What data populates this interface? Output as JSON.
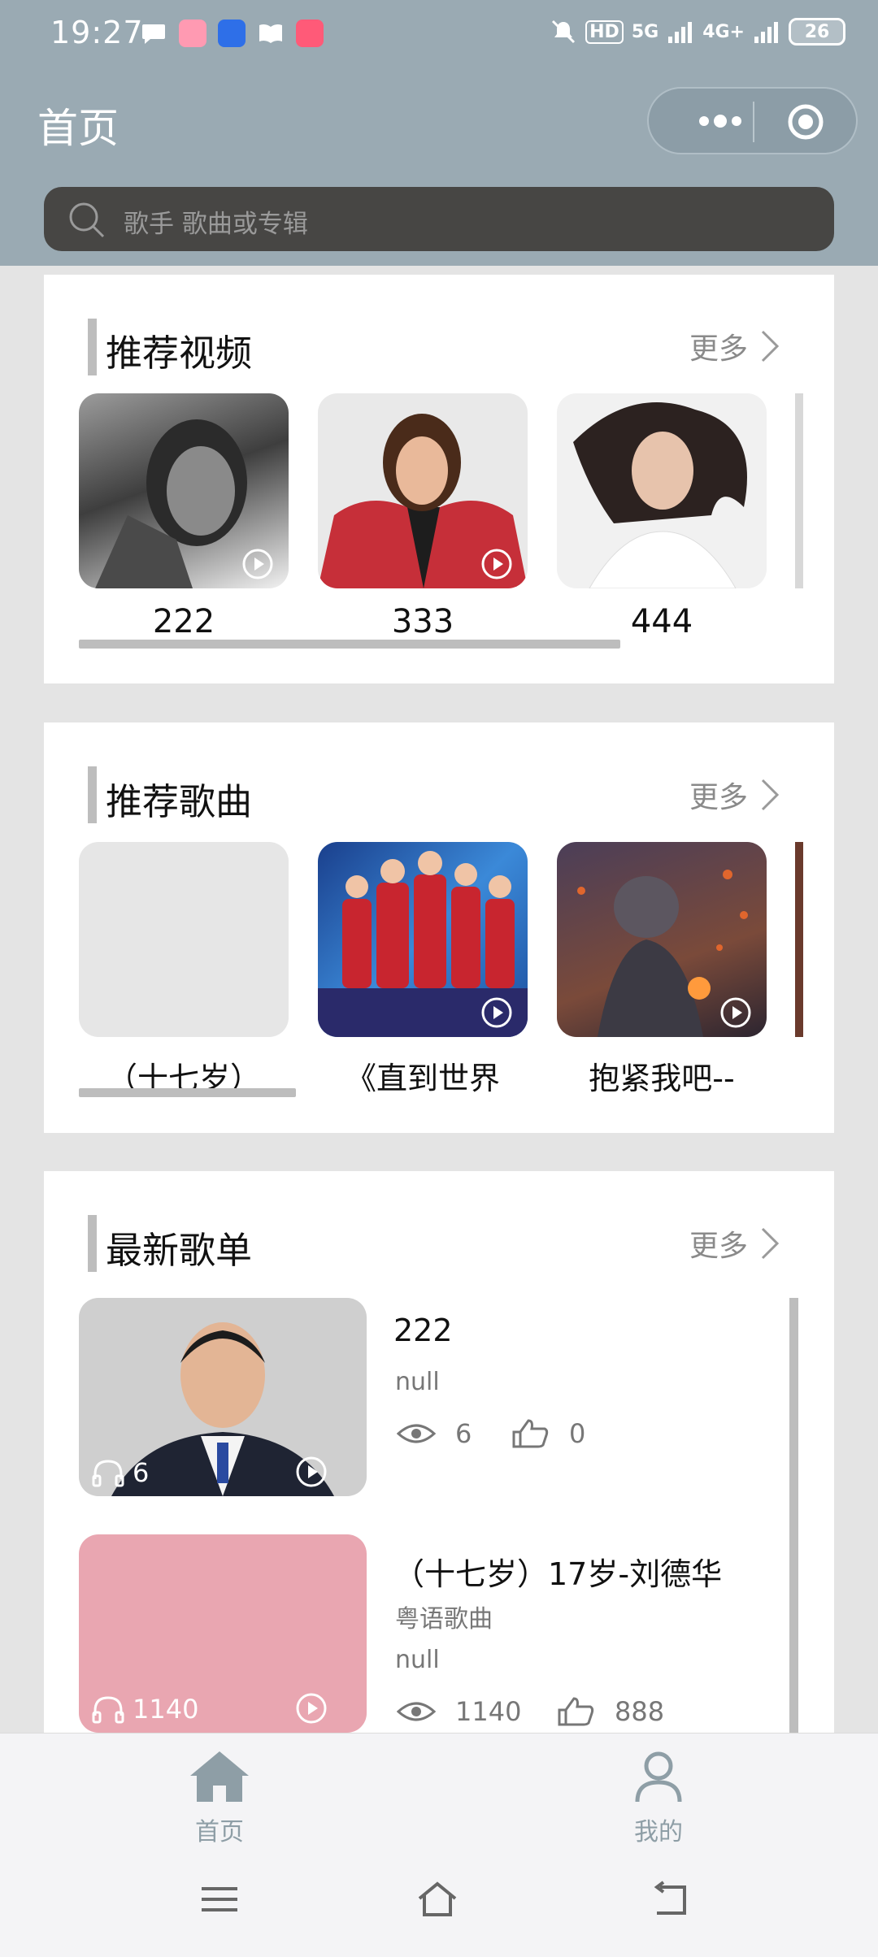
{
  "status_bar": {
    "time": "19:27",
    "signal_labels": [
      "HD",
      "5G",
      "4G+"
    ],
    "battery": "26"
  },
  "header": {
    "title": "首页",
    "capsule_more_icon": "more-dots-icon",
    "capsule_close_icon": "target-icon"
  },
  "search": {
    "placeholder": "歌手 歌曲或专辑"
  },
  "sections": {
    "videos": {
      "title": "推荐视频",
      "more": "更多",
      "items": [
        {
          "label": "222",
          "color": "#6b6b6b"
        },
        {
          "label": "333",
          "color": "#c62f39"
        },
        {
          "label": "444",
          "color": "#ececec"
        }
      ],
      "scroll_fraction": 0.74
    },
    "songs": {
      "title": "推荐歌曲",
      "more": "更多",
      "items": [
        {
          "label": "（十七岁）",
          "color": "#e6e6e6"
        },
        {
          "label": "《直到世界",
          "color": "#2d6fc0"
        },
        {
          "label": "抱紧我吧--",
          "color": "#4a3e4a"
        }
      ],
      "scroll_fraction": 0.3
    },
    "playlists": {
      "title": "最新歌单",
      "more": "更多",
      "items": [
        {
          "title": "222",
          "subtitle": "",
          "desc": "null",
          "plays": "6",
          "views": "6",
          "likes": "0",
          "color": "#9a9a9a"
        },
        {
          "title": "（十七岁）17岁-刘德华",
          "subtitle": "粤语歌曲",
          "desc": "null",
          "plays": "1140",
          "views": "1140",
          "likes": "888",
          "color": "#e9a6b1"
        }
      ]
    }
  },
  "tabbar": {
    "items": [
      {
        "label": "首页",
        "icon": "home-icon",
        "active": true
      },
      {
        "label": "我的",
        "icon": "user-icon",
        "active": false
      }
    ]
  },
  "nav": {
    "icons": [
      "menu-icon",
      "home-outline-icon",
      "back-icon"
    ]
  },
  "colors": {
    "header": "#9aaab3",
    "search_bg": "#474644",
    "accent": "#8e9ea6",
    "scrollbar": "#bdbdbd"
  }
}
